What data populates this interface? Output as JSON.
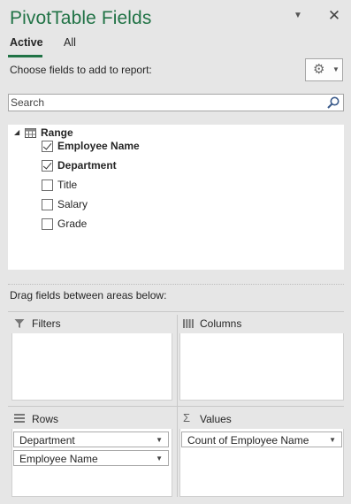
{
  "header": {
    "title": "PivotTable Fields",
    "dropdown_icon": "chevron-down-icon",
    "close_icon": "close-icon"
  },
  "tabs": [
    {
      "label": "Active",
      "selected": true
    },
    {
      "label": "All",
      "selected": false
    }
  ],
  "choose_label": "Choose fields to add to report:",
  "tools_button": {
    "icon": "gear-icon"
  },
  "search": {
    "placeholder": "Search",
    "value": ""
  },
  "field_list": {
    "group": "Range",
    "fields": [
      {
        "label": "Employee Name",
        "checked": true
      },
      {
        "label": "Department",
        "checked": true
      },
      {
        "label": "Title",
        "checked": false
      },
      {
        "label": "Salary",
        "checked": false
      },
      {
        "label": "Grade",
        "checked": false
      }
    ]
  },
  "drag_label": "Drag fields between areas below:",
  "areas": {
    "filters": {
      "label": "Filters",
      "icon": "filter-icon",
      "items": []
    },
    "columns": {
      "label": "Columns",
      "icon": "columns-icon",
      "items": []
    },
    "rows": {
      "label": "Rows",
      "icon": "rows-icon",
      "items": [
        "Department",
        "Employee Name"
      ]
    },
    "values": {
      "label": "Values",
      "icon": "sigma-icon",
      "items": [
        "Count of Employee Name"
      ]
    }
  },
  "colors": {
    "accent": "#217346",
    "panel_bg": "#e6e6e6"
  }
}
